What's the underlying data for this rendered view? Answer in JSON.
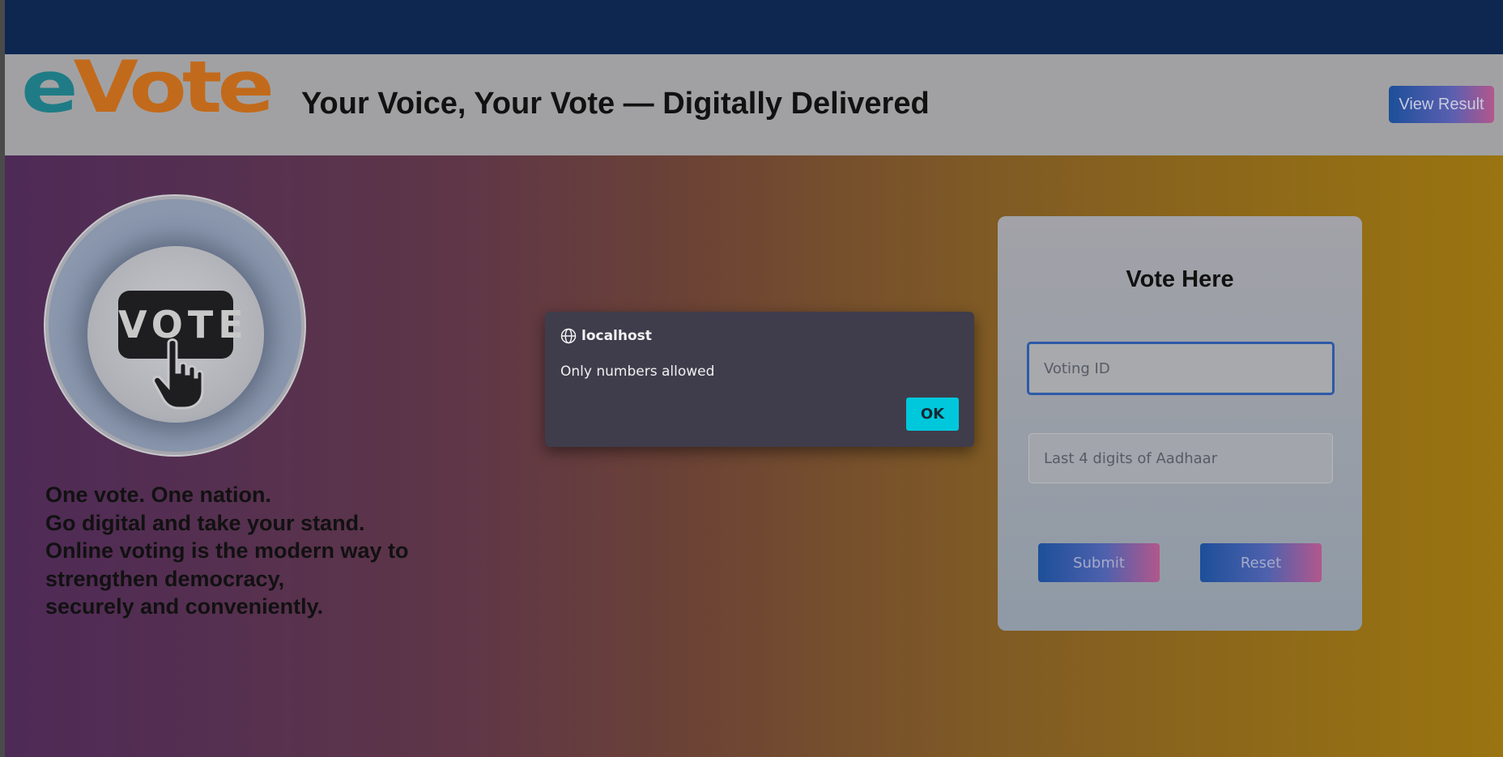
{
  "header": {
    "logo_e": "e",
    "logo_vote": "Vote",
    "tagline": "Your Voice, Your Vote — Digitally Delivered",
    "view_result_label": "View Result"
  },
  "hero": {
    "badge_text": "VOTE",
    "slogan_lines": [
      "One vote. One nation.",
      "Go digital and take your stand.",
      "Online voting is the modern way to",
      "strengthen democracy,",
      "securely and conveniently."
    ]
  },
  "vote_form": {
    "title": "Vote Here",
    "voting_id_placeholder": "Voting ID",
    "aadhaar_placeholder": "Last 4 digits of Aadhaar",
    "submit_label": "Submit",
    "reset_label": "Reset"
  },
  "alert": {
    "origin": "localhost",
    "message": "Only numbers allowed",
    "ok_label": "OK"
  },
  "colors": {
    "topbar": "#0d2750",
    "logo_e": "#1f7c86",
    "logo_vote": "#c26a1b",
    "ok_button": "#00c8dc"
  },
  "icons": {
    "dialog": "globe-icon",
    "hero": "hand-pointer-icon"
  }
}
